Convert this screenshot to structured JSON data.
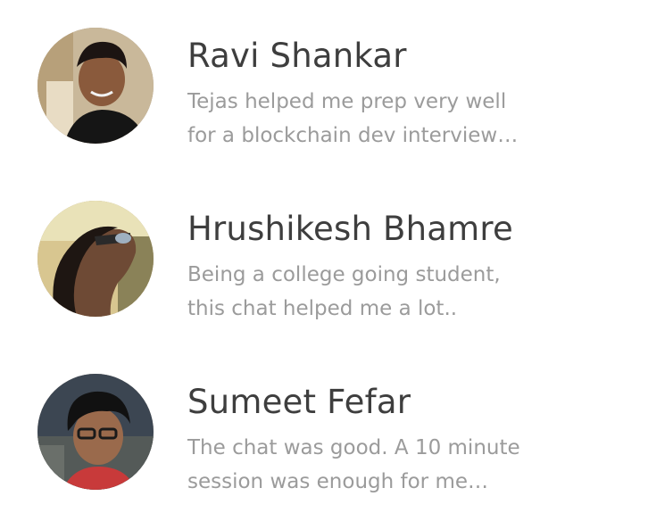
{
  "testimonials": [
    {
      "name": "Ravi Shankar",
      "quote_lines": [
        "Tejas helped me prep very well",
        "for a blockchain dev interview…"
      ]
    },
    {
      "name": "Hrushikesh Bhamre",
      "quote_lines": [
        "Being a college going student,",
        "this chat helped me a lot.."
      ]
    },
    {
      "name": "Sumeet Fefar",
      "quote_lines": [
        "The chat was good. A 10 minute",
        "session was enough for me…"
      ]
    }
  ],
  "colors": {
    "name_text": "#3e3e3e",
    "quote_text": "#9b9b9b",
    "background": "#ffffff"
  }
}
